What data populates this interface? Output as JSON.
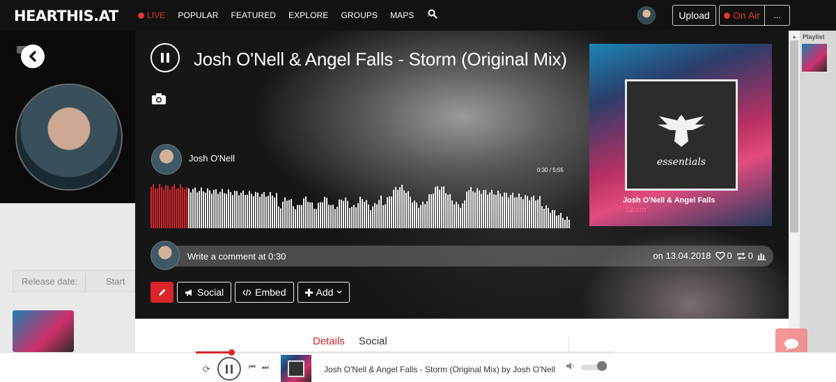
{
  "nav": {
    "logo": "HEARTHIS.AT",
    "live": "LIVE",
    "links": [
      "POPULAR",
      "FEATURED",
      "EXPLORE",
      "GROUPS",
      "MAPS",
      "···"
    ],
    "upload": "Upload",
    "on_air": "On Air",
    "more": "...",
    "accent_color": "#e0362b"
  },
  "background_page": {
    "release_label": "Release date:",
    "start_label": "Start"
  },
  "track": {
    "title": "Josh O'Nell & Angel Falls - Storm (Original Mix)",
    "artist": "Josh O'Nell",
    "time": "0:30 / 5:55",
    "progress_fraction": 0.085,
    "cover": {
      "label": "essentials",
      "artist": "Josh O'Nell & Angel Falls",
      "track": "\"Storm\""
    }
  },
  "comment": {
    "placeholder": "Write a comment at 0:30",
    "date": "on 13.04.2018",
    "likes": "0",
    "reposts": "0"
  },
  "actions": {
    "social": "Social",
    "embed": "Embed",
    "add": "Add"
  },
  "tabs": {
    "details": "Details",
    "social": "Social"
  },
  "playlist": {
    "label": "Playlist"
  },
  "player": {
    "title": "Josh O'Nell & Angel Falls - Storm (Original Mix) by Josh O'Nell",
    "progress_fraction": 0.085,
    "volume_fraction": 0.6
  },
  "icons": [
    "pause-icon",
    "camera-icon",
    "chevron-left-icon",
    "search-icon",
    "heart-icon",
    "repost-icon",
    "stats-icon",
    "pencil-icon",
    "megaphone-icon",
    "code-icon",
    "plus-icon",
    "repeat-icon",
    "prev-icon",
    "next-icon",
    "volume-icon",
    "chat-icon"
  ]
}
